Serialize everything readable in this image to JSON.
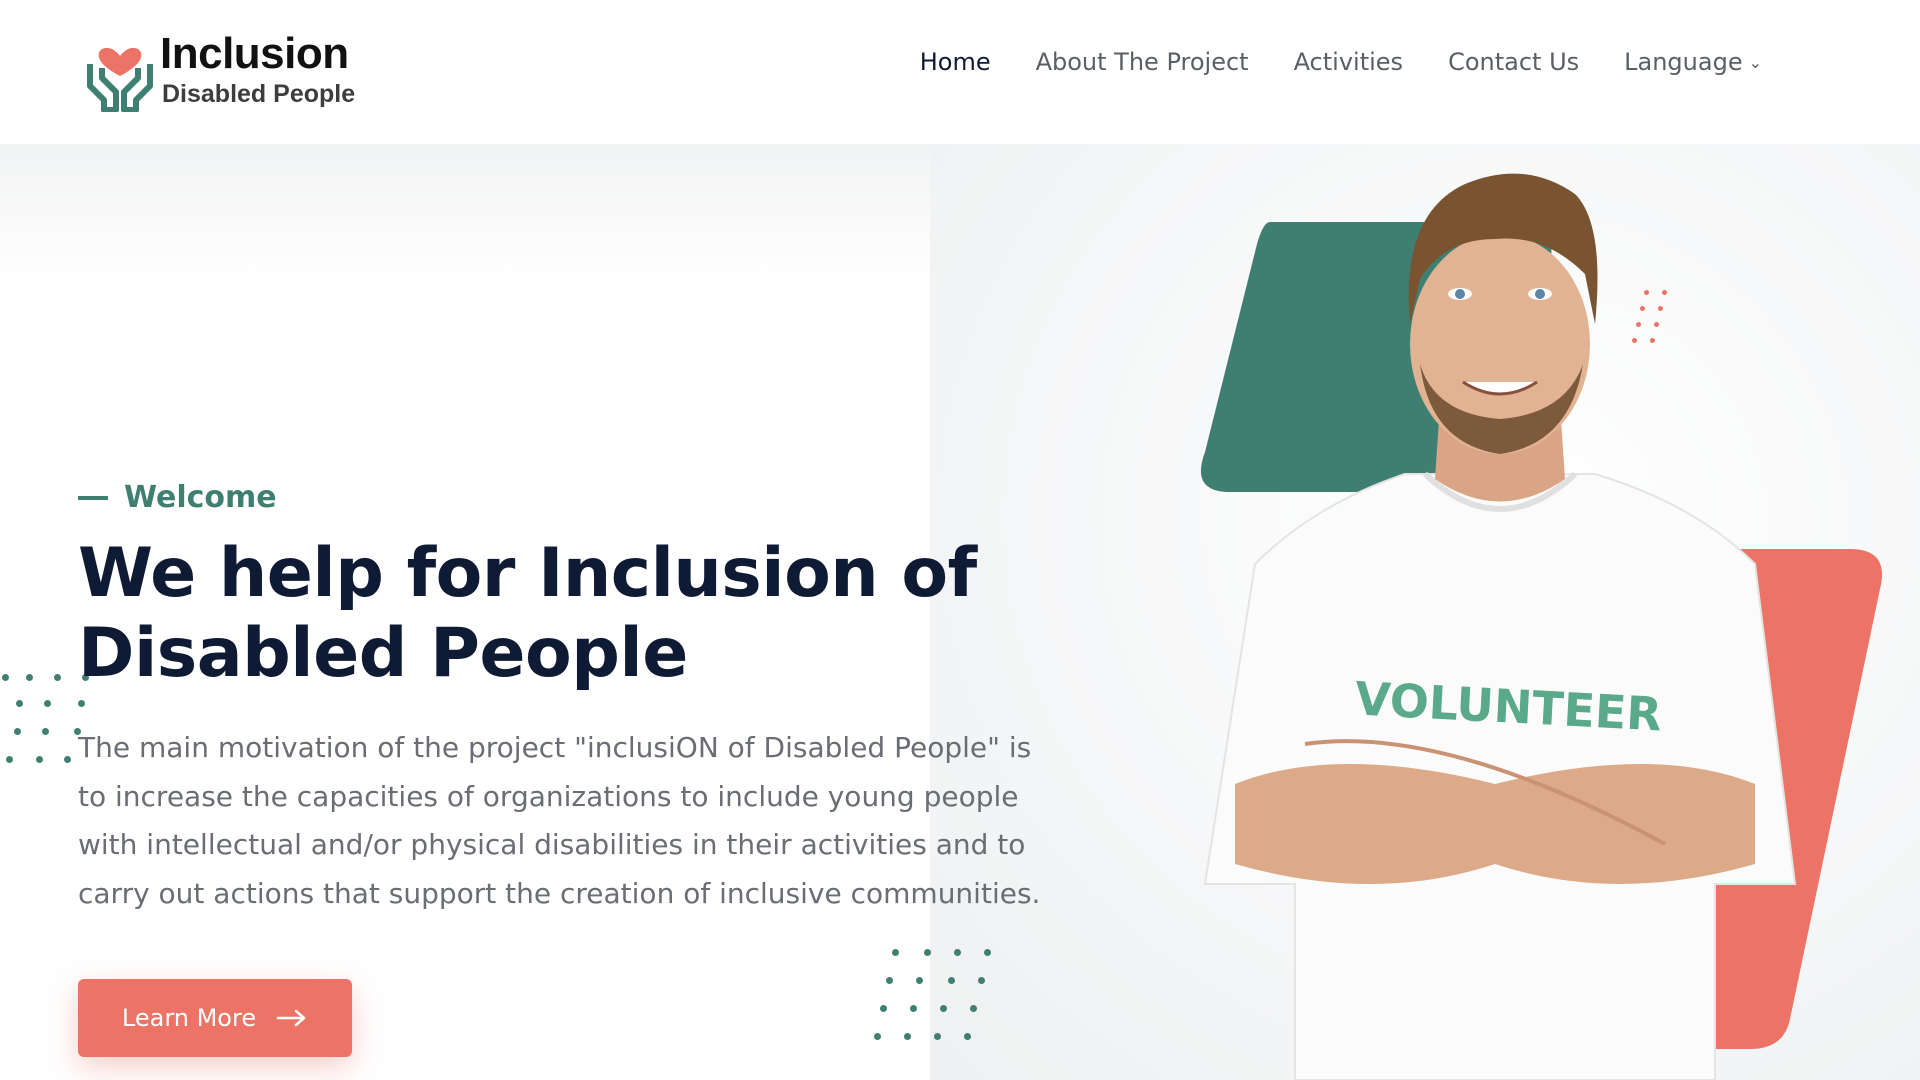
{
  "logo": {
    "title": "Inclusion",
    "subtitle": "Disabled People"
  },
  "nav": {
    "items": [
      {
        "label": "Home",
        "active": true
      },
      {
        "label": "About The Project",
        "active": false
      },
      {
        "label": "Activities",
        "active": false
      },
      {
        "label": "Contact Us",
        "active": false
      },
      {
        "label": "Language",
        "active": false,
        "dropdown": true
      }
    ]
  },
  "hero": {
    "eyebrow": "Welcome",
    "title_line1": "We help for Inclusion of",
    "title_line2": "Disabled People",
    "description": "The main motivation of the project \"inclusiON of Disabled People\" is to increase the capacities of organizations to include young people with intellectual and/or physical disabilities in their activities and to carry out actions that support the creation of inclusive communities.",
    "cta_label": "Learn More",
    "shirt_text": "VOLUNTEER"
  },
  "colors": {
    "accent_green": "#3f7f72",
    "accent_coral": "#ec7365",
    "heading": "#0f1b35",
    "body_text": "#6a6e74"
  }
}
